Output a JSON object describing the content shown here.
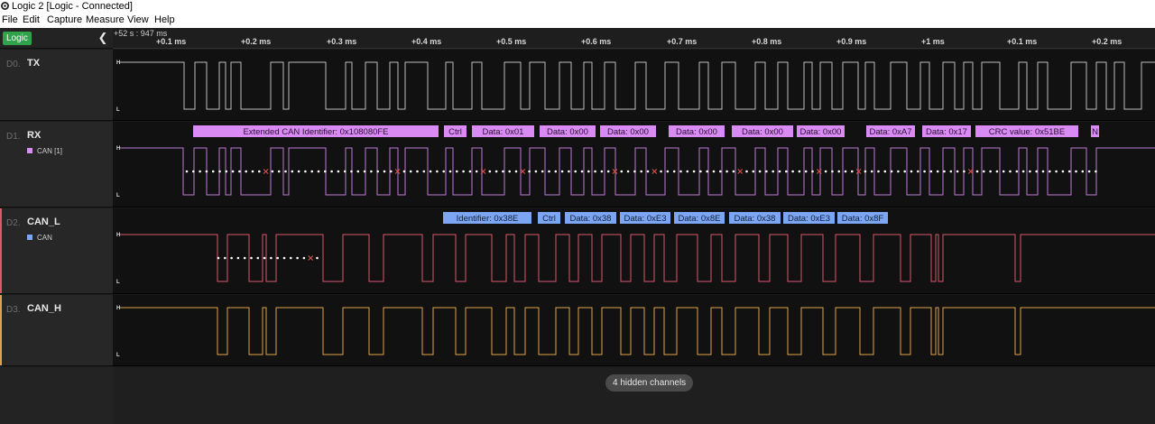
{
  "window": {
    "title": "Logic 2 [Logic - Connected]"
  },
  "menu": [
    "File",
    "Edit",
    "Capture",
    "Measure",
    "View",
    "Help"
  ],
  "sidebar": {
    "badge": "Logic",
    "collapse_icon": "chevron-left-icon"
  },
  "timeline": {
    "anchor": "+52 s : 947 ms",
    "ticks": [
      "+0.1 ms",
      "+0.2 ms",
      "+0.3 ms",
      "+0.4 ms",
      "+0.5 ms",
      "+0.6 ms",
      "+0.7 ms",
      "+0.8 ms",
      "+0.9 ms",
      "+1 ms",
      "+0.1 ms",
      "+0.2 ms"
    ]
  },
  "levels": {
    "high": "H",
    "low": "L"
  },
  "channels": [
    {
      "index": "D0.",
      "name": "TX",
      "analyzer": "",
      "color": "#bdbdbd"
    },
    {
      "index": "D1.",
      "name": "RX",
      "analyzer": "CAN [1]",
      "color": "#c07bd6",
      "analyzer_color": "#d88cf5"
    },
    {
      "index": "D2.",
      "name": "CAN_L",
      "analyzer": "CAN",
      "color": "#d9596a",
      "analyzer_color": "#7aa7f5"
    },
    {
      "index": "D3.",
      "name": "CAN_H",
      "analyzer": "",
      "color": "#e0a24a"
    }
  ],
  "rx_frames": [
    "Extended CAN Identifier: 0x108080FE",
    "Ctrl",
    "Data: 0x01",
    "Data: 0x00",
    "Data: 0x00",
    "Data: 0x00",
    "Data: 0x00",
    "Data: 0x00",
    "Data: 0xA7",
    "Data: 0x17",
    "CRC value: 0x51BE",
    "N"
  ],
  "canl_frames": [
    "Identifier: 0x38E",
    "Ctrl",
    "Data: 0x38",
    "Data: 0xE3",
    "Data: 0x8E",
    "Data: 0x38",
    "Data: 0xE3",
    "Data: 0x8F"
  ],
  "footer": {
    "hidden_channels": "4 hidden channels"
  }
}
